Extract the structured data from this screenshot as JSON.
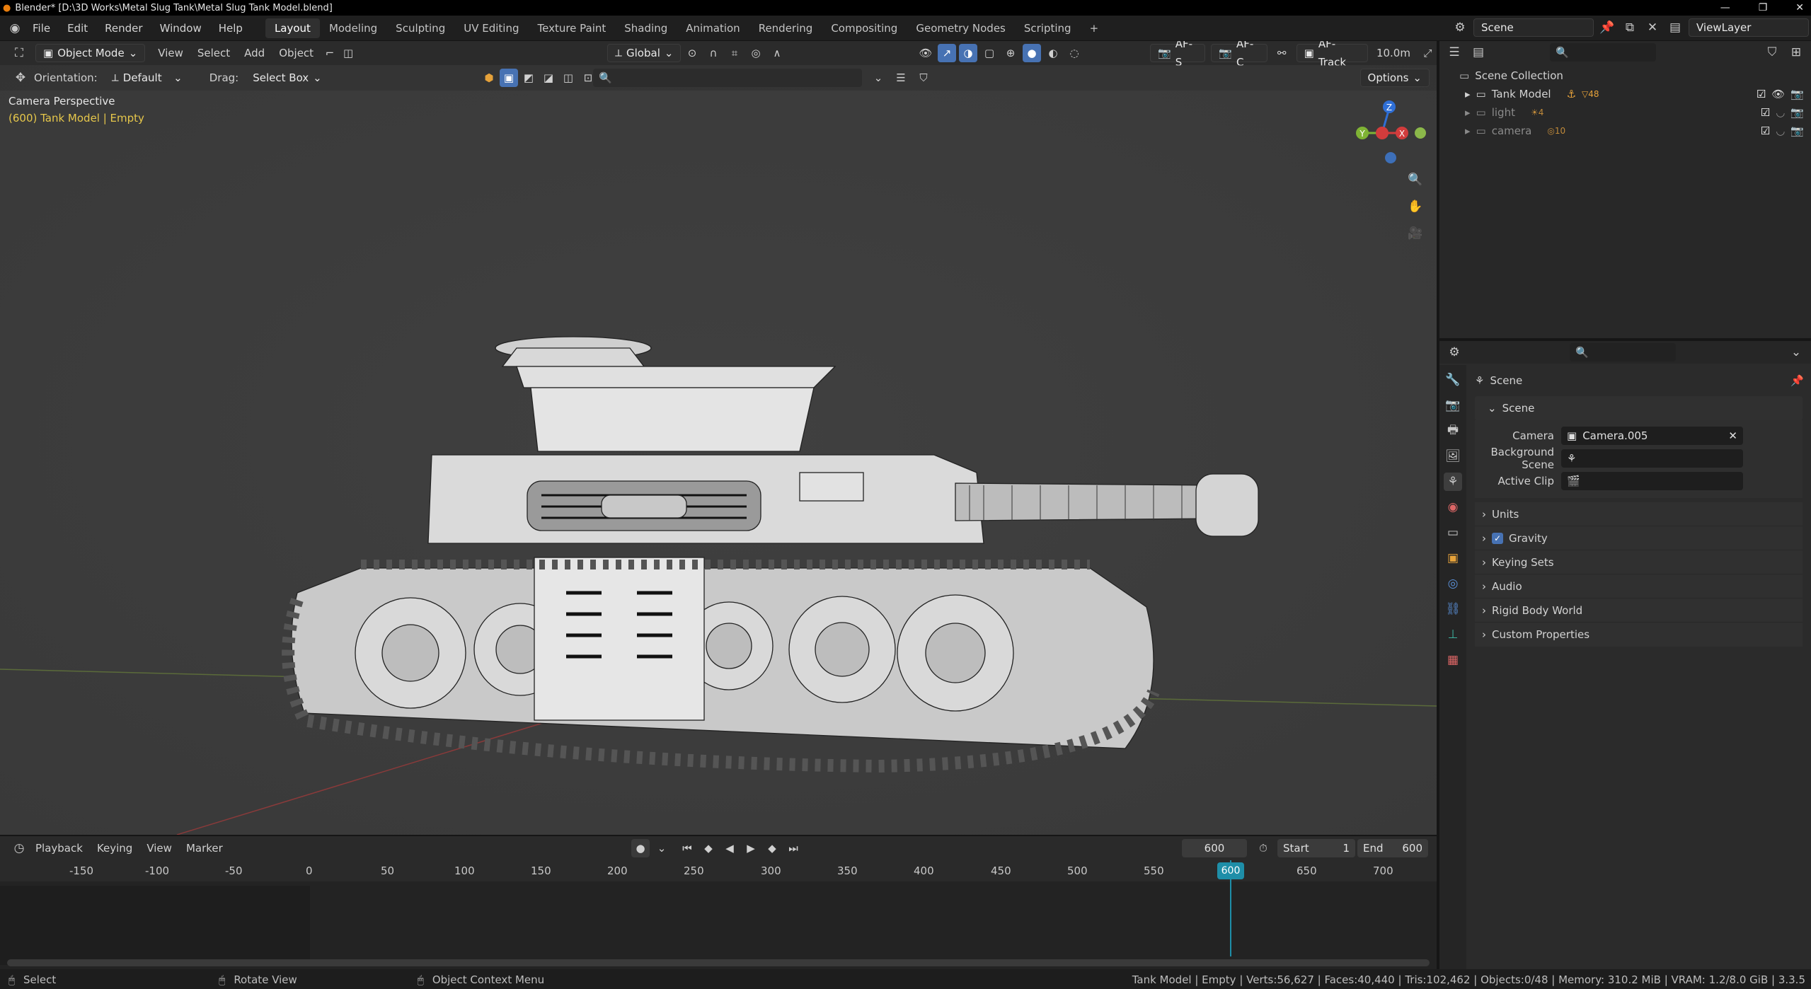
{
  "window": {
    "title": "Blender* [D:\\3D Works\\Metal Slug Tank\\Metal Slug Tank Model.blend]"
  },
  "menu": [
    "File",
    "Edit",
    "Render",
    "Window",
    "Help"
  ],
  "workspaces": [
    "Layout",
    "Modeling",
    "Sculpting",
    "UV Editing",
    "Texture Paint",
    "Shading",
    "Animation",
    "Rendering",
    "Compositing",
    "Geometry Nodes",
    "Scripting"
  ],
  "active_workspace": "Layout",
  "scene_selector": {
    "scene": "Scene",
    "view_layer": "ViewLayer"
  },
  "viewport": {
    "mode": "Object Mode",
    "menus": [
      "View",
      "Select",
      "Add",
      "Object"
    ],
    "transform_orientation": "Global",
    "orientation_label": "Orientation:",
    "orientation_value": "Default",
    "drag_label": "Drag:",
    "drag_value": "Select Box",
    "options_label": "Options",
    "af_s": "AF-S",
    "af_c": "AF-C",
    "af_track": "AF-Track",
    "distance": "10.0m",
    "perspective_label": "Camera Perspective",
    "object_info": "(600) Tank Model | Empty",
    "gizmo": {
      "z": "Z",
      "y": "Y",
      "x": "X"
    }
  },
  "outliner": {
    "root": "Scene Collection",
    "items": [
      {
        "name": "Tank Model",
        "badge": "48"
      },
      {
        "name": "light",
        "badge": "4"
      },
      {
        "name": "camera",
        "badge": "10"
      }
    ]
  },
  "properties": {
    "breadcrumb": "Scene",
    "panel_title": "Scene",
    "camera_label": "Camera",
    "camera_value": "Camera.005",
    "background_scene_label": "Background Scene",
    "active_clip_label": "Active Clip",
    "subpanels": [
      "Units",
      "Gravity",
      "Keying Sets",
      "Audio",
      "Rigid Body World",
      "Custom Properties"
    ]
  },
  "timeline": {
    "menus": [
      "Playback",
      "Keying",
      "View",
      "Marker"
    ],
    "current_frame": "600",
    "start_label": "Start",
    "start_value": "1",
    "end_label": "End",
    "end_value": "600",
    "ticks": [
      "-150",
      "-100",
      "-50",
      "0",
      "50",
      "100",
      "150",
      "200",
      "250",
      "300",
      "350",
      "400",
      "450",
      "500",
      "550",
      "600",
      "650",
      "700"
    ]
  },
  "statusbar": {
    "left": [
      "Select",
      "Rotate View",
      "Object Context Menu"
    ],
    "right": "Tank Model | Empty | Verts:56,627 | Faces:40,440 | Tris:102,462 | Objects:0/48 | Memory: 310.2 MiB | VRAM: 1.2/8.0 GiB | 3.3.5"
  },
  "colors": {
    "accent": "#4772b3",
    "frame": "#1e8ea8",
    "object_text": "#e6c74b"
  }
}
